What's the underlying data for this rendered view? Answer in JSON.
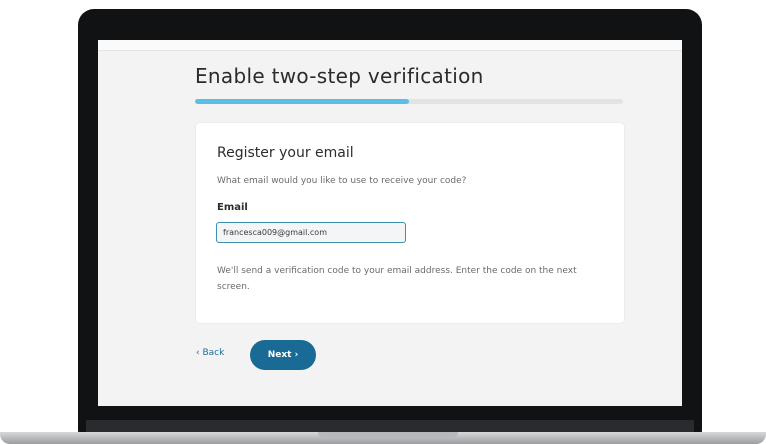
{
  "page": {
    "title": "Enable two-step verification",
    "progress_fraction": 0.5
  },
  "card": {
    "title": "Register your email",
    "question": "What email would you like to use to receive your code?",
    "field_label": "Email",
    "email_value": "francesca009@gmail.com",
    "note": "We'll send a verification code to your email address. Enter the code on the next screen."
  },
  "actions": {
    "back_label": "‹ Back",
    "next_label": "Next ›"
  },
  "colors": {
    "progress": "#5cbde9",
    "primary_button": "#1a6a96",
    "link": "#1f6f96"
  }
}
